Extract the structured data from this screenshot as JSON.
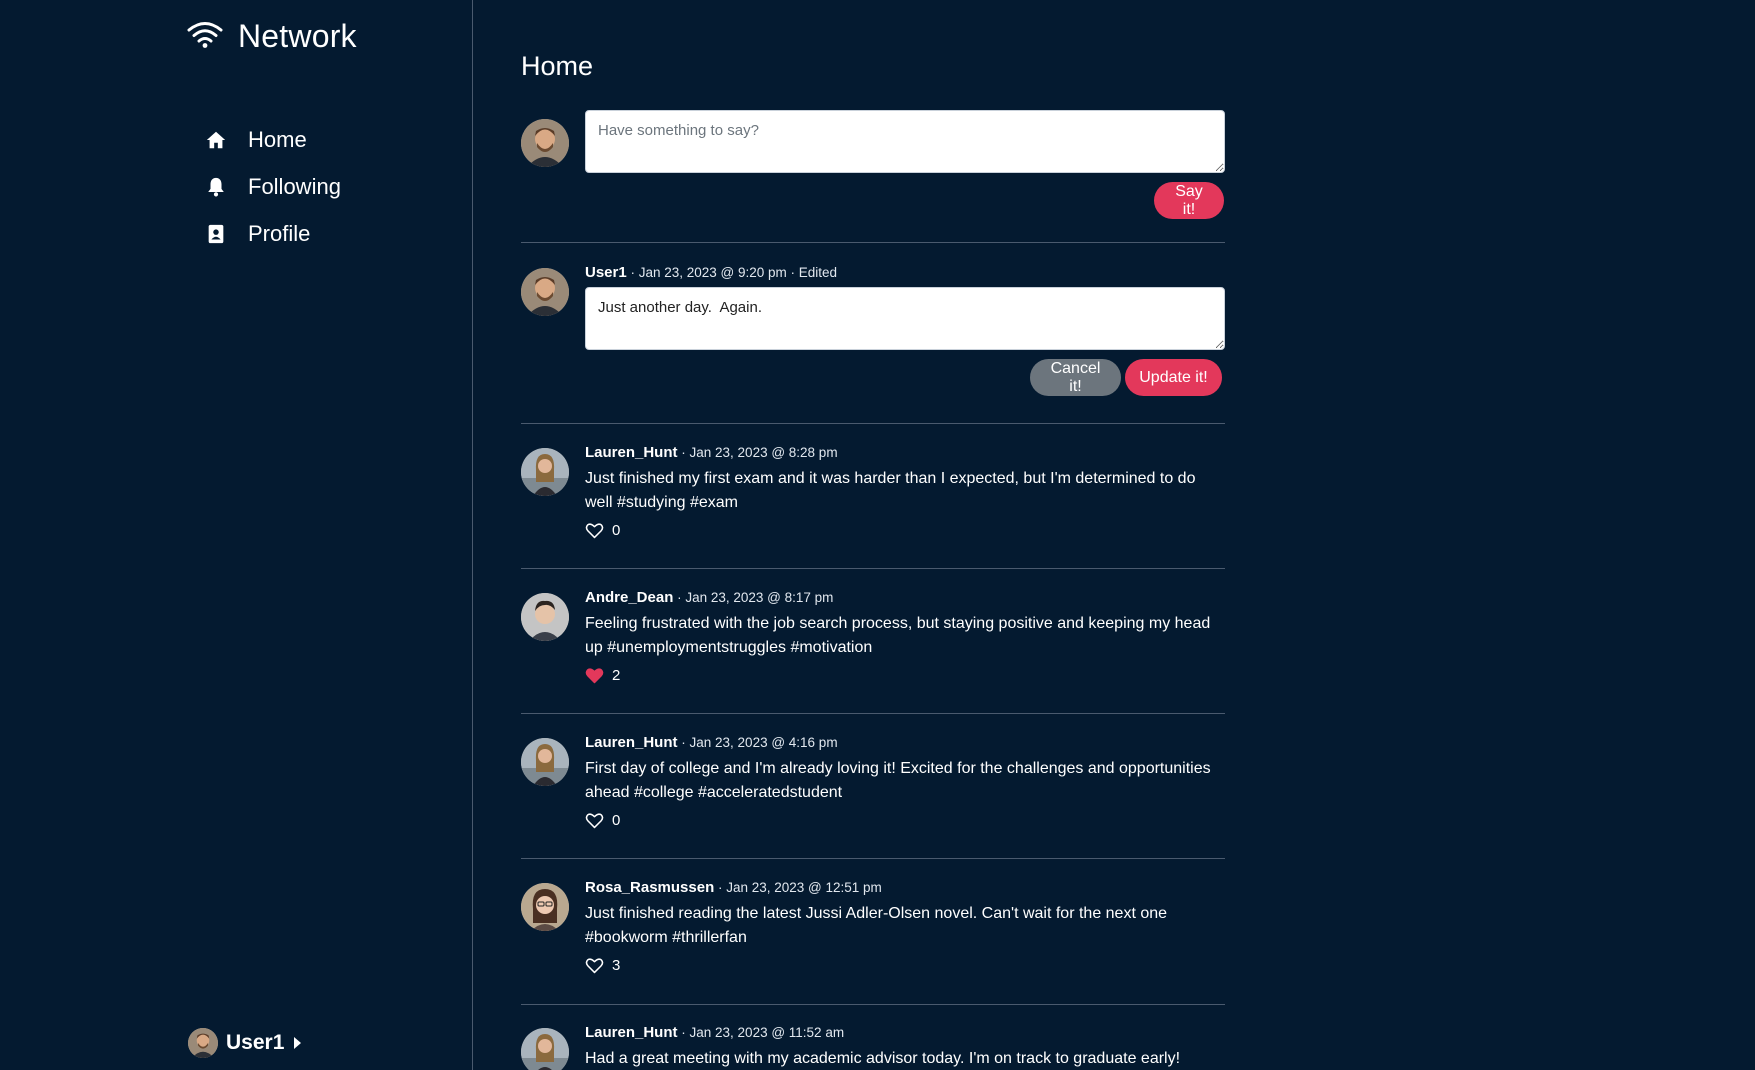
{
  "brand": {
    "name": "Network",
    "icon": "wifi-icon"
  },
  "nav": [
    {
      "label": "Home",
      "icon": "home-icon"
    },
    {
      "label": "Following",
      "icon": "bell-icon"
    },
    {
      "label": "Profile",
      "icon": "contact-book-icon"
    }
  ],
  "current_user": {
    "name": "User1"
  },
  "main": {
    "title": "Home",
    "composer": {
      "placeholder": "Have something to say?",
      "value": "",
      "submit_label": "Say it!"
    },
    "editing_post": {
      "author": "User1",
      "date": " · Jan 23, 2023 @ 9:20 pm · Edited",
      "text": "Just another day.  Again.",
      "cancel_label": "Cancel it!",
      "update_label": "Update it!"
    },
    "posts": [
      {
        "author": "Lauren_Hunt",
        "date": " · Jan 23, 2023 @ 8:28 pm",
        "text": "Just finished my first exam and it was harder than I expected, but I'm determined to do well #studying #exam",
        "likes": "0",
        "liked": false
      },
      {
        "author": "Andre_Dean",
        "date": " · Jan 23, 2023 @ 8:17 pm",
        "text": "Feeling frustrated with the job search process, but staying positive and keeping my head up #unemploymentstruggles #motivation",
        "likes": "2",
        "liked": true
      },
      {
        "author": "Lauren_Hunt",
        "date": " · Jan 23, 2023 @ 4:16 pm",
        "text": "First day of college and I'm already loving it! Excited for the challenges and opportunities ahead #college #acceleratedstudent",
        "likes": "0",
        "liked": false
      },
      {
        "author": "Rosa_Rasmussen",
        "date": " · Jan 23, 2023 @ 12:51 pm",
        "text": "Just finished reading the latest Jussi Adler-Olsen novel. Can't wait for the next one #bookworm #thrillerfan",
        "likes": "3",
        "liked": false
      },
      {
        "author": "Lauren_Hunt",
        "date": " · Jan 23, 2023 @ 11:52 am",
        "text": "Had a great meeting with my academic advisor today. I'm on track to graduate early!",
        "likes": "",
        "liked": false
      }
    ]
  },
  "colors": {
    "background": "#041a30",
    "accent": "#e3385b",
    "secondary": "#6c757d",
    "divider": "#4a5a6e"
  }
}
